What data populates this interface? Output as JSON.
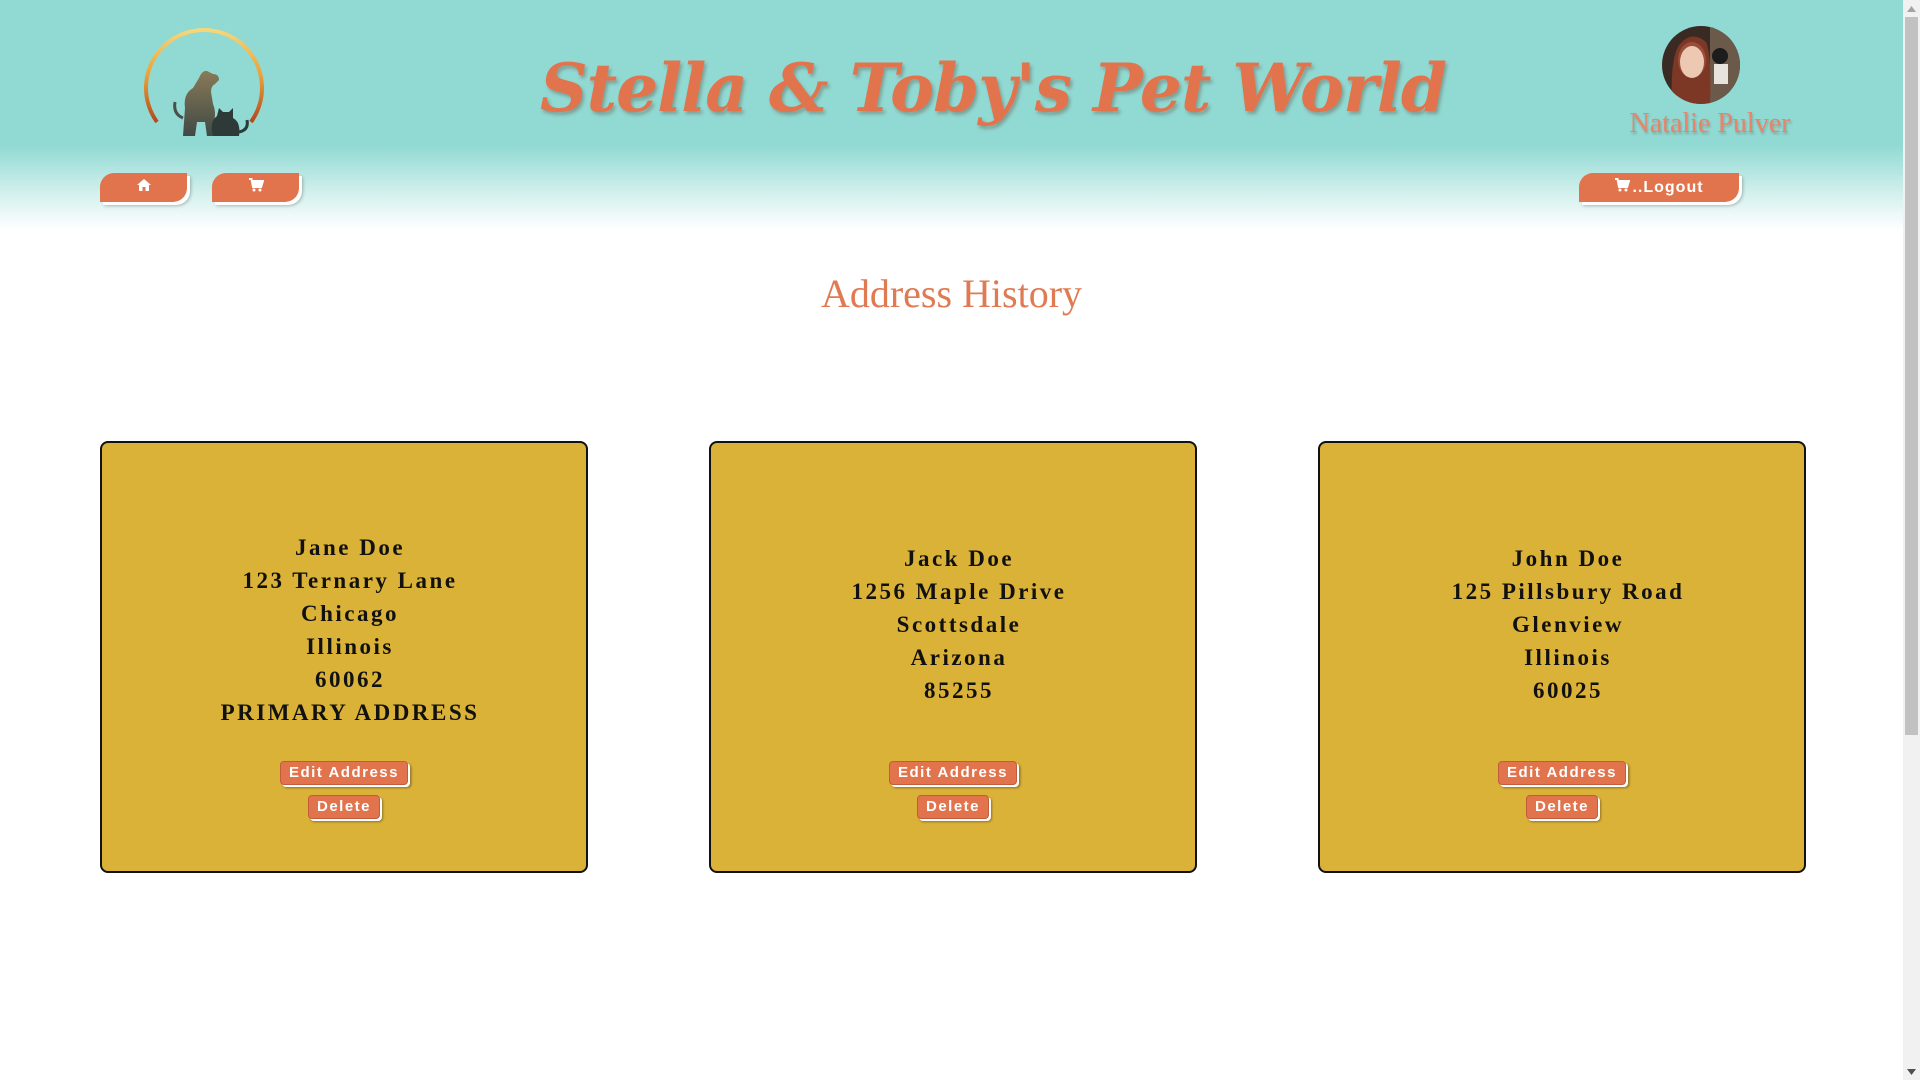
{
  "header": {
    "site_title": "Stella & Toby's Pet World",
    "user_name": "Natalie Pulver",
    "logo_icon": "dog-and-cat-logo-icon",
    "avatar_icon": "user-avatar-photo"
  },
  "nav": {
    "home_icon": "home-icon",
    "cart_icon": "shopping-cart-icon",
    "logout_label": "..Logout",
    "logout_icon": "cart-icon"
  },
  "main": {
    "title": "Address History",
    "addresses": [
      {
        "name": "Jane Doe",
        "street": "123 Ternary Lane",
        "city": "Chicago",
        "state": "Illinois",
        "zip": "60062",
        "primary_label": "PRIMARY ADDRESS",
        "edit_label": "Edit Address",
        "delete_label": "Delete"
      },
      {
        "name": "Jack Doe",
        "street": "1256 Maple Drive",
        "city": "Scottsdale",
        "state": "Arizona",
        "zip": "85255",
        "edit_label": "Edit Address",
        "delete_label": "Delete"
      },
      {
        "name": "John Doe",
        "street": "125 Pillsbury Road",
        "city": "Glenview",
        "state": "Illinois",
        "zip": "60025",
        "edit_label": "Edit Address",
        "delete_label": "Delete"
      }
    ]
  },
  "colors": {
    "header_teal": "#91d9d3",
    "accent_orange": "#e2744d",
    "card_gold": "#dbb238",
    "title_orange": "#df7a52"
  }
}
